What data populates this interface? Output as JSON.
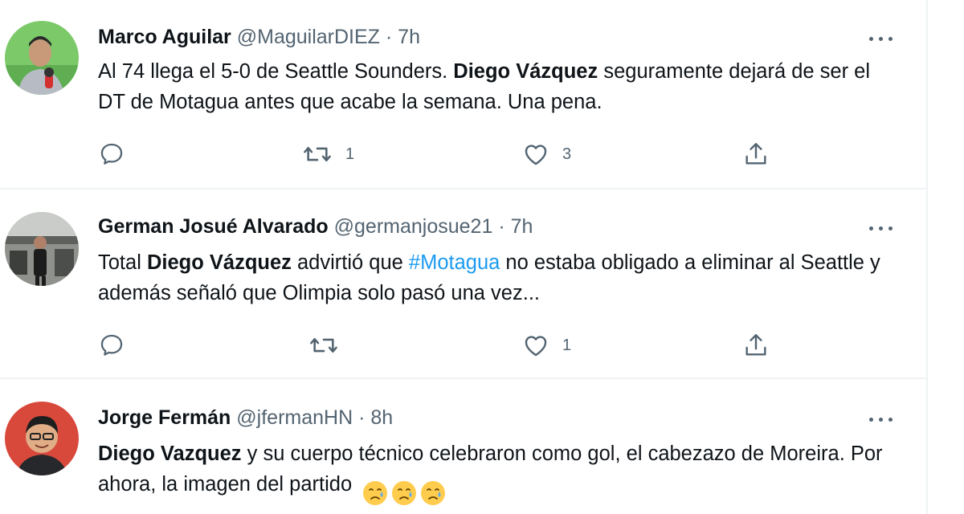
{
  "tweets": [
    {
      "name": "Marco Aguilar",
      "handle": "@MaguilarDIEZ",
      "separator": "·",
      "time": "7h",
      "text": {
        "part1": "Al 74 llega el 5-0 de Seattle Sounders. ",
        "bold1": "Diego Vázquez",
        "part2": " seguramente dejará de ser el DT de Motagua antes que acabe la semana. Una pena."
      },
      "reply_count": "",
      "retweet_count": "1",
      "like_count": "3"
    },
    {
      "name": "German Josué Alvarado",
      "handle": "@germanjosue21",
      "separator": "·",
      "time": "7h",
      "text": {
        "part1": "Total ",
        "bold1": "Diego Vázquez",
        "part2": " advirtió que ",
        "hashtag": "#Motagua",
        "part3": " no estaba obligado a eliminar al Seattle y además señaló que Olimpia solo pasó una vez..."
      },
      "reply_count": "",
      "retweet_count": "",
      "like_count": "1"
    },
    {
      "name": "Jorge Fermán",
      "handle": "@jfermanHN",
      "separator": "·",
      "time": "8h",
      "text": {
        "bold1": "Diego Vazquez",
        "part1": " y su cuerpo técnico celebraron como gol, el cabezazo de Moreira. Por ahora, la imagen del partido ",
        "emojis": [
          "😥",
          "😥",
          "😥"
        ]
      }
    }
  ],
  "icons": {
    "reply": "reply-icon",
    "retweet": "retweet-icon",
    "like": "heart-icon",
    "share": "share-icon",
    "more": "more-icon"
  },
  "colors": {
    "text": "#0f1419",
    "secondary": "#536471",
    "link": "#1d9bf0",
    "divider": "#eff3f4"
  }
}
